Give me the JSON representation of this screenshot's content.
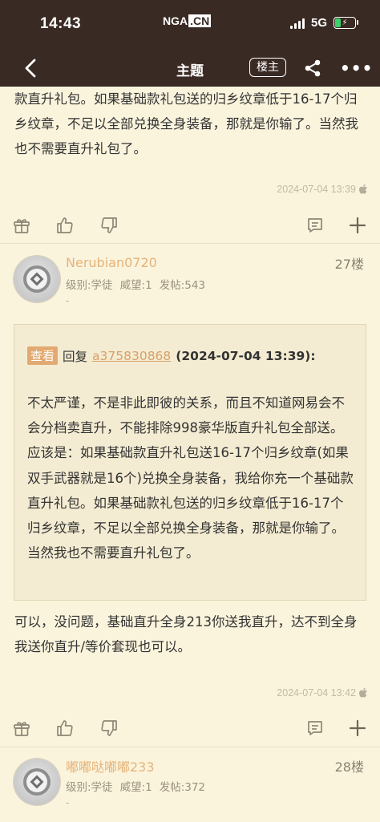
{
  "status_bar": {
    "time": "14:43",
    "logo_nga": "NGA",
    "logo_cn": ".CN",
    "network": "5G"
  },
  "nav": {
    "title": "主题",
    "owner_button": "楼主"
  },
  "post_top": {
    "text": "款直升礼包。如果基础款礼包送的归乡纹章低于16-17个归乡纹章，不足以全部兑换全身装备，那就是你输了。当然我也不需要直升礼包了。",
    "timestamp": "2024-07-04 13:39"
  },
  "post_27": {
    "username": "Nerubian0720",
    "floor": "27楼",
    "level": "级别:学徒",
    "prestige": "威望:1",
    "posts": "发帖:543",
    "sig": "-",
    "quote": {
      "badge": "查看",
      "reply_word": "回复",
      "reply_user": "a375830868",
      "reply_date": "(2024-07-04 13:39):",
      "body": "不太严谨，不是非此即彼的关系，而且不知道网易会不会分档卖直升，不能排除998豪华版直升礼包全部送。应该是：如果基础款直升礼包送16-17个归乡纹章(如果双手武器就是16个)兑换全身装备，我给你充一个基础款直升礼包。如果基础款礼包送的归乡纹章低于16-17个归乡纹章，不足以全部兑换全身装备，那就是你输了。当然我也不需要直升礼包了。"
    },
    "text": "可以，没问题，基础直升全身213你送我直升，达不到全身我送你直升/等价套现也可以。",
    "timestamp": "2024-07-04 13:42"
  },
  "post_28": {
    "username": "嘟嘟哒嘟嘟233",
    "floor": "28楼",
    "level": "级别:学徒",
    "prestige": "威望:1",
    "posts": "发帖:372",
    "sig": "-"
  },
  "icons": [
    "back-icon",
    "share-icon",
    "more-icon",
    "gift-icon",
    "thumb-up-icon",
    "thumb-down-icon",
    "comment-icon",
    "plus-icon",
    "apple-icon"
  ]
}
